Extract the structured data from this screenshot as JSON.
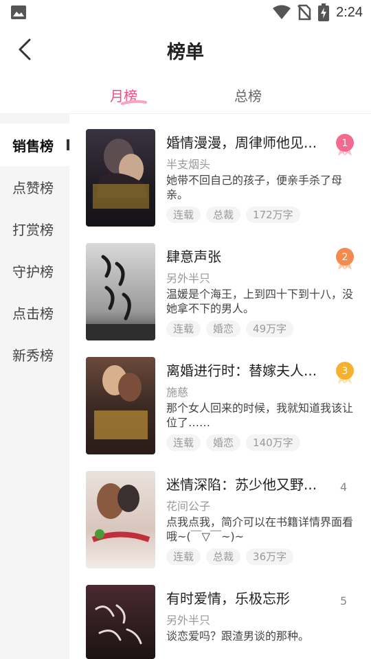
{
  "status_bar": {
    "time": "2:24",
    "left_icon": "image-icon",
    "icons": [
      "wifi-icon",
      "no-sim-icon",
      "battery-charging-icon"
    ]
  },
  "header": {
    "title": "榜单",
    "back_icon": "back-arrow-icon"
  },
  "tabs": [
    {
      "label": "月榜",
      "active": true
    },
    {
      "label": "总榜",
      "active": false
    }
  ],
  "sidebar": {
    "items": [
      {
        "label": "销售榜",
        "active": true
      },
      {
        "label": "点赞榜"
      },
      {
        "label": "打赏榜"
      },
      {
        "label": "守护榜"
      },
      {
        "label": "点击榜"
      },
      {
        "label": "新秀榜"
      }
    ]
  },
  "books": [
    {
      "rank": "1",
      "title": "婚情漫漫，周律师他见...",
      "author": "半支烟头",
      "desc": "她带不回自己的孩子，便亲手杀了母亲。",
      "tags": [
        "连载",
        "总裁",
        "172万字"
      ]
    },
    {
      "rank": "2",
      "title": "肆意声张",
      "author": "另外半只",
      "desc": "温媛是个海王，上到四十下到十八，没她拿不下的男人。",
      "tags": [
        "连载",
        "婚恋",
        "49万字"
      ]
    },
    {
      "rank": "3",
      "title": "离婚进行时：替嫁夫人...",
      "author": "施慈",
      "desc": "那个女人回来的时候，我就知道我该让位了……",
      "tags": [
        "连载",
        "婚恋",
        "140万字"
      ]
    },
    {
      "rank": "4",
      "title": "迷情深陷：苏少他又野...",
      "author": "花间公子",
      "desc": "点我点我，简介可以在书籍详情界面看哦~(￣▽￣~)~",
      "tags": [
        "连载",
        "总裁",
        "36万字"
      ]
    },
    {
      "rank": "5",
      "title": "有时爱情，乐极忘形",
      "author": "另外半只",
      "desc": "谈恋爱吗？跟渣男谈的那种。",
      "tags": []
    }
  ],
  "colors": {
    "accent": "#ef4e83",
    "medal_1": "#f46a8e",
    "medal_2": "#f58a4e",
    "medal_3": "#f5b12c"
  }
}
